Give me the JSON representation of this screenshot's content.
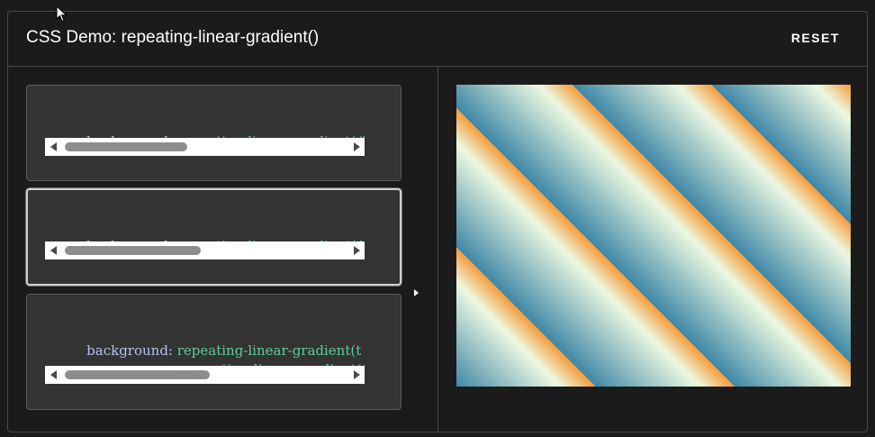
{
  "header": {
    "title": "CSS Demo: repeating-linear-gradient()",
    "reset_label": "RESET"
  },
  "options": [
    {
      "property": "background",
      "lines": [
        "repeating-linear-gradient(#"
      ],
      "selected": false,
      "scroll_thumb_fraction": 0.39
    },
    {
      "property": "background",
      "lines": [
        "repeating-linear-gradient(4"
      ],
      "selected": true,
      "scroll_thumb_fraction": 0.45
    },
    {
      "property": "background",
      "lines": [
        "repeating-linear-gradient(t",
        "repeating-linear-gradient(("
      ],
      "selected": false,
      "scroll_thumb_fraction": 0.48
    }
  ],
  "colors": {
    "gradient_blue": "#3f87a6",
    "gradient_cream": "#ebf8e1",
    "gradient_orange": "#f69d3c",
    "code_property": "#b7c0ee",
    "code_function": "#5fcb9c",
    "selected_border": "#d0d0d0"
  },
  "icons": {
    "selected_option_indicator": "triangle-right-icon",
    "scroll_left": "triangle-left-icon",
    "scroll_right": "triangle-right-icon",
    "mouse_cursor": "arrow-cursor-icon"
  }
}
